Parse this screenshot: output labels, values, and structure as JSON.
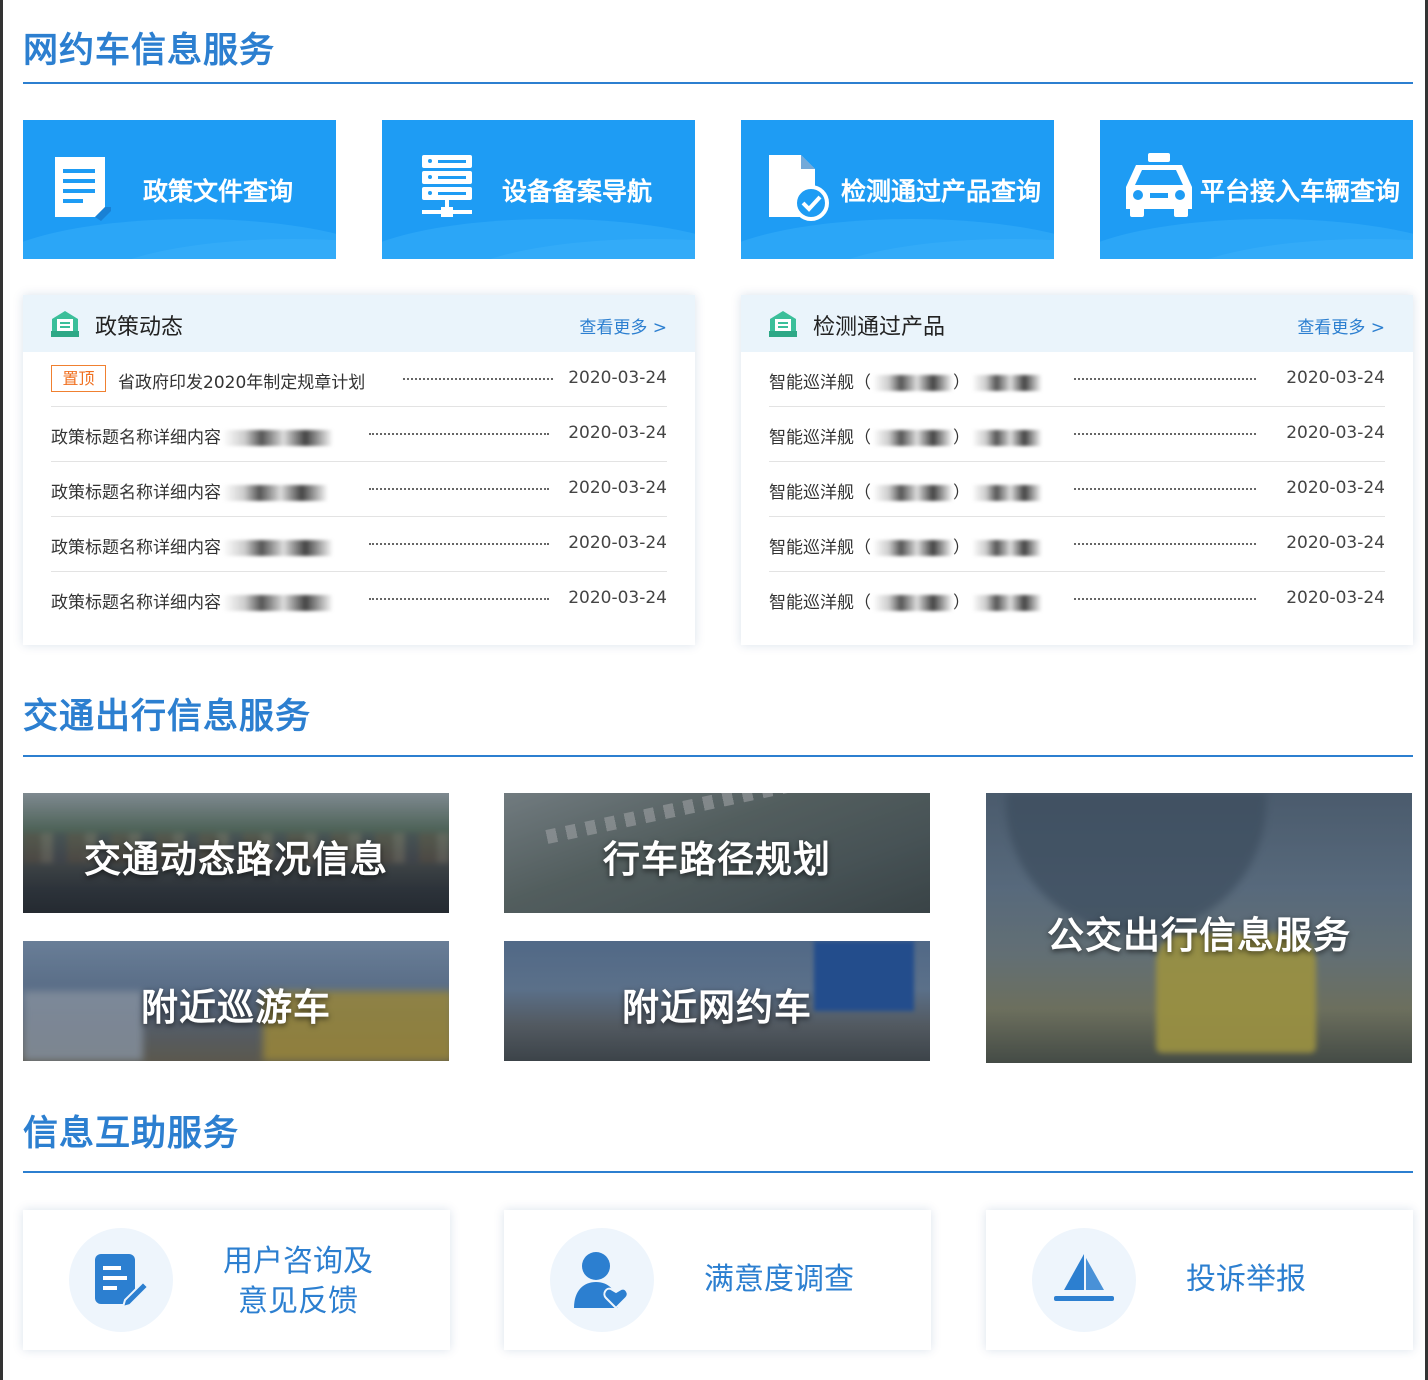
{
  "sections": {
    "ride_hailing": "网约车信息服务",
    "traffic": "交通出行信息服务",
    "help": "信息互助服务"
  },
  "quick_links": [
    {
      "label": "政策文件查询",
      "icon": "document-icon"
    },
    {
      "label": "设备备案导航",
      "icon": "server-icon"
    },
    {
      "label": "检测通过产品查询",
      "icon": "file-check-icon"
    },
    {
      "label": "平台接入车辆查询",
      "icon": "taxi-icon"
    }
  ],
  "policy_panel": {
    "title": "政策动态",
    "more": "查看更多 >",
    "pin_label": "置顶",
    "rows": [
      {
        "title": "省政府印发2020年制定规章计划",
        "date": "2020-03-24"
      },
      {
        "title": "政策标题名称详细内容",
        "date": "2020-03-24"
      },
      {
        "title": "政策标题名称详细内容",
        "date": "2020-03-24"
      },
      {
        "title": "政策标题名称详细内容",
        "date": "2020-03-24"
      },
      {
        "title": "政策标题名称详细内容",
        "date": "2020-03-24"
      }
    ]
  },
  "product_panel": {
    "title": "检测通过产品",
    "more": "查看更多 >",
    "rows": [
      {
        "title": "智能巡洋舰（",
        "date": "2020-03-24"
      },
      {
        "title": "智能巡洋舰（",
        "date": "2020-03-24"
      },
      {
        "title": "智能巡洋舰（",
        "date": "2020-03-24"
      },
      {
        "title": "智能巡洋舰（",
        "date": "2020-03-24"
      },
      {
        "title": "智能巡洋舰（",
        "date": "2020-03-24"
      }
    ]
  },
  "traffic_tiles": [
    {
      "label": "交通动态路况信息"
    },
    {
      "label": "行车路径规划"
    },
    {
      "label": "公交出行信息服务"
    },
    {
      "label": "附近巡游车"
    },
    {
      "label": "附近网约车"
    }
  ],
  "help_cards": [
    {
      "line1": "用户咨询及",
      "line2": "意见反馈",
      "icon": "edit-document-icon"
    },
    {
      "label": "满意度调查",
      "icon": "user-heart-icon"
    },
    {
      "label": "投诉举报",
      "icon": "sailboat-icon"
    }
  ],
  "colors": {
    "accent": "#2c7fd0",
    "button_blue": "#1e9cf4",
    "pin_orange": "#f07020"
  }
}
